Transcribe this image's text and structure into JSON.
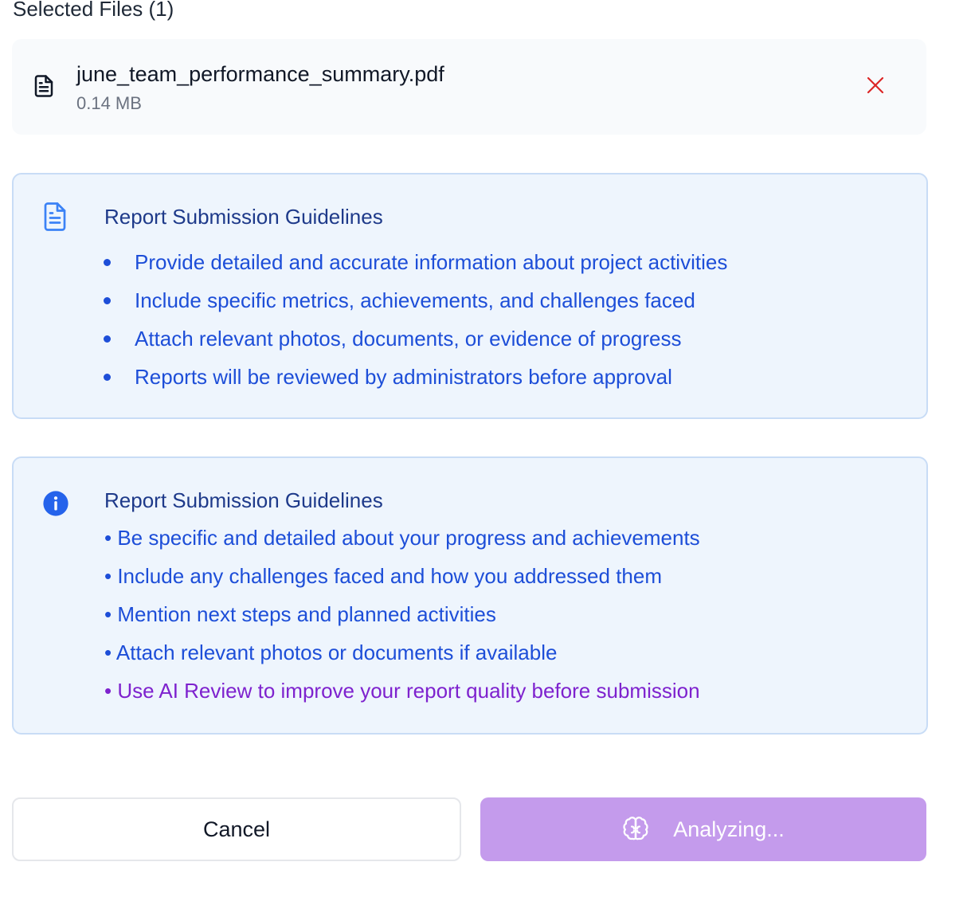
{
  "selected_files": {
    "title": "Selected Files (1)",
    "files": [
      {
        "name": "june_team_performance_summary.pdf",
        "size": "0.14 MB",
        "icon": "file-text-icon",
        "remove_icon": "close-icon"
      }
    ]
  },
  "guidelines_primary": {
    "icon": "document-icon",
    "title": "Report Submission Guidelines",
    "items": [
      "Provide detailed and accurate information about project activities",
      "Include specific metrics, achievements, and challenges faced",
      "Attach relevant photos, documents, or evidence of progress",
      "Reports will be reviewed by administrators before approval"
    ]
  },
  "guidelines_secondary": {
    "icon": "info-icon",
    "title": "Report Submission Guidelines",
    "items": [
      "• Be specific and detailed about your progress and achievements",
      "• Include any challenges faced and how you addressed them",
      "• Mention next steps and planned activities",
      "• Attach relevant photos or documents if available"
    ],
    "ai_tip": "• Use AI Review to improve your report quality before submission"
  },
  "actions": {
    "cancel_label": "Cancel",
    "analyze_label": "Analyzing...",
    "analyze_icon": "brain-icon"
  },
  "colors": {
    "panel_bg": "#eef5fd",
    "panel_border": "#c8dcf6",
    "guideline_text": "#1d4ed8",
    "guideline_title": "#1e3a8a",
    "ai_tip_text": "#7e22ce",
    "remove_icon": "#dc2626",
    "analyze_button_bg": "#c49bec"
  }
}
